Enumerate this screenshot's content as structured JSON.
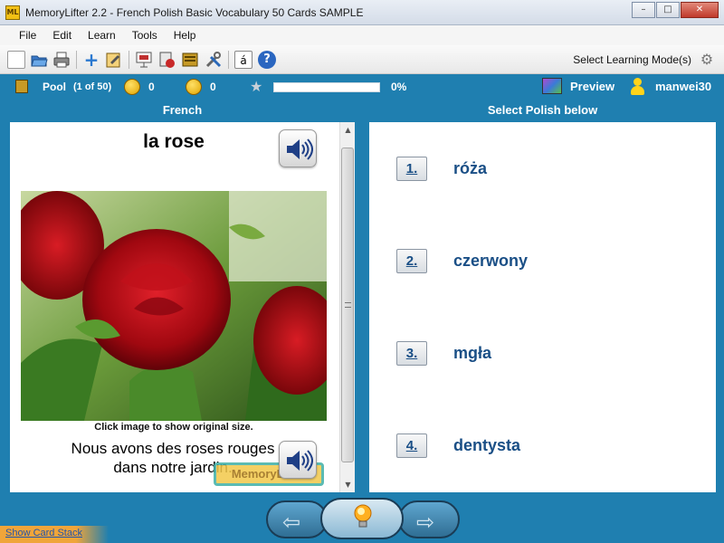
{
  "window": {
    "app_icon_label": "ML",
    "title": "MemoryLifter 2.2 - French Polish Basic Vocabulary 50 Cards SAMPLE",
    "minimize_glyph": "–",
    "maximize_glyph": "□",
    "close_glyph": "✕"
  },
  "menu": [
    "File",
    "Edit",
    "Learn",
    "Tools",
    "Help"
  ],
  "toolbar": {
    "icons": [
      "new-icon",
      "open-icon",
      "print-icon",
      "add-icon",
      "edit-icon",
      "slideshow-icon",
      "statistics-icon",
      "card-box-icon",
      "tools-icon",
      "special-char-icon",
      "help-icon"
    ],
    "special_char_glyph": "á",
    "help_glyph": "?",
    "mode_label": "Select Learning Mode(s)"
  },
  "status": {
    "pool_label": "Pool",
    "pool_count": "(1 of 50)",
    "happy_count": "0",
    "sad_count": "0",
    "progress_percent": "0%",
    "progress_value": 0,
    "preview_label": "Preview",
    "username": "manwei30"
  },
  "question": {
    "header": "French",
    "word": "la rose",
    "image_caption": "Click image to show original size.",
    "example_sentence": "Nous avons des roses rouges dans notre jardin.",
    "watermark": "MemoryLifter"
  },
  "answers": {
    "header": "Select Polish below",
    "options": [
      {
        "number": "1.",
        "text": "róża"
      },
      {
        "number": "2.",
        "text": "czerwony"
      },
      {
        "number": "3.",
        "text": "mgła"
      },
      {
        "number": "4.",
        "text": "dentysta"
      }
    ]
  },
  "navigation": {
    "back_glyph": "⇦",
    "forward_glyph": "⇨",
    "show_card_stack": "Show Card Stack"
  },
  "colors": {
    "frame_blue": "#1f7fb0",
    "answer_text": "#1a4f86",
    "accent_orange": "#f0a53a"
  }
}
